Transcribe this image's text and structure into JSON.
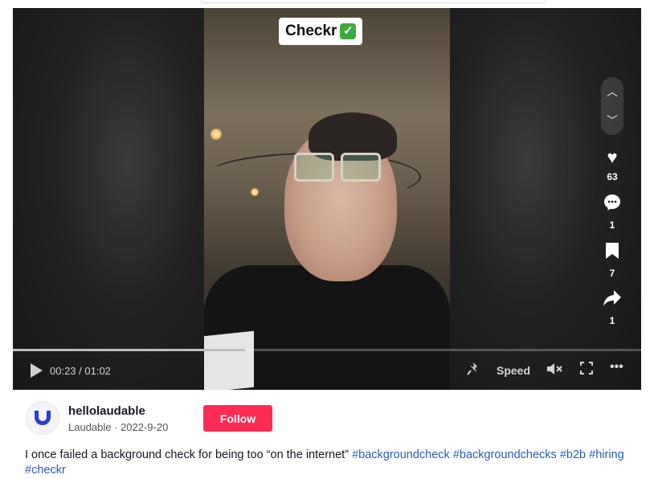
{
  "video": {
    "overlay_text": "Checkr",
    "overlay_emoji": "✅",
    "time_display": "00:23 / 01:02",
    "progress": 0.37,
    "speed_label": "Speed",
    "actions": [
      {
        "icon": "heart-icon",
        "count": "63"
      },
      {
        "icon": "comment-icon",
        "count": "1"
      },
      {
        "icon": "bookmark-icon",
        "count": "7"
      },
      {
        "icon": "share-icon",
        "count": "1"
      }
    ]
  },
  "author": {
    "username": "hellolaudable",
    "display_name": "Laudable",
    "separator": " · ",
    "date": "2022-9-20",
    "follow_label": "Follow"
  },
  "description": {
    "text": "I once failed a background check for being too “on the internet” ",
    "hashtags": [
      "#backgroundcheck",
      "#backgroundchecks",
      "#b2b",
      "#hiring",
      "#checkr"
    ]
  },
  "colors": {
    "follow": "#fe2c55",
    "hashtag": "#2b5db3",
    "avatar_brand": "#2a3bd9"
  }
}
